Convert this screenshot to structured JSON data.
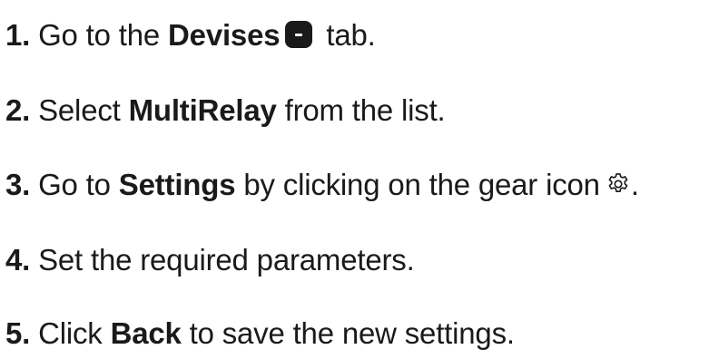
{
  "steps": [
    {
      "number": "1.",
      "before": " Go to the ",
      "bold": "Devises",
      "after": " tab.",
      "icon": "device-tab-icon"
    },
    {
      "number": "2.",
      "before": " Select ",
      "bold": "MultiRelay",
      "after": " from the list."
    },
    {
      "number": "3.",
      "before": " Go to ",
      "bold": "Settings",
      "after": " by clicking on the gear icon",
      "end": ".",
      "icon": "gear-icon"
    },
    {
      "number": "4.",
      "text": " Set the required parameters."
    },
    {
      "number": "5.",
      "before": " Click ",
      "bold": "Back",
      "after": " to save the new settings."
    }
  ]
}
